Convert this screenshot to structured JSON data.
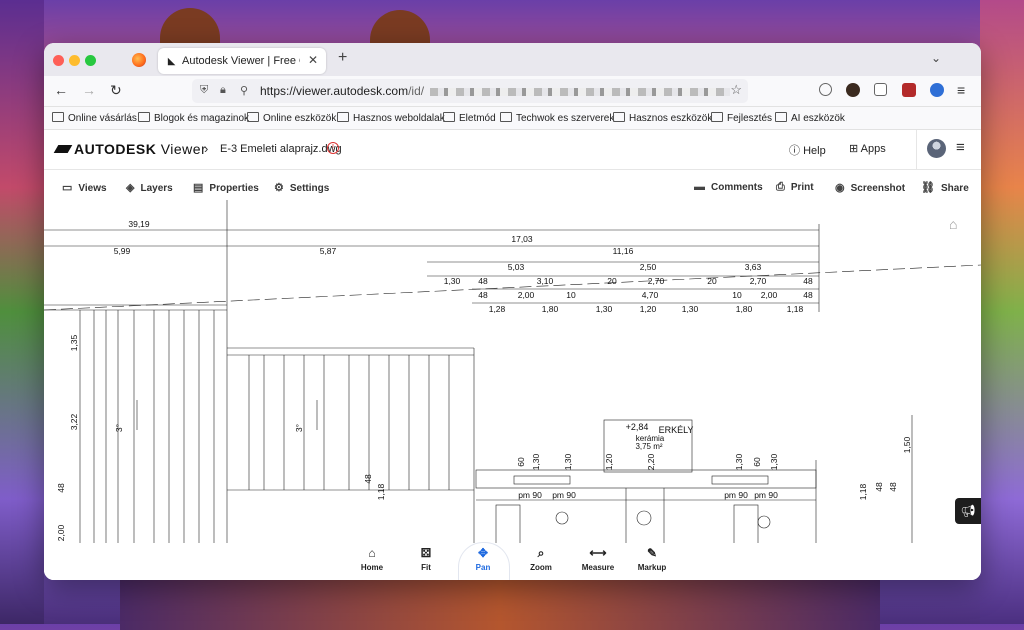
{
  "browser": {
    "tab_title": "Autodesk Viewer | Free Online F",
    "url_host": "https://viewer.autodesk.com",
    "url_path": "/id/"
  },
  "bookmarks": [
    "Online vásárlás",
    "Blogok és magazinok",
    "Online eszközök",
    "Hasznos weboldalak",
    "Eletmód",
    "Techwok es szerverek",
    "Hasznos eszközök",
    "Fejlesztés",
    "AI eszközök"
  ],
  "app": {
    "logo_bold": "AUTODESK",
    "logo_light": "Viewer",
    "file_name": "E-3 Emeleti alaprajz.dwg",
    "help_label": "Help",
    "apps_label": "Apps"
  },
  "toolbar": {
    "views": "Views",
    "layers": "Layers",
    "properties": "Properties",
    "settings": "Settings",
    "comments": "Comments",
    "print": "Print",
    "screenshot": "Screenshot",
    "share": "Share"
  },
  "bottom_tools": {
    "home": "Home",
    "fit": "Fit",
    "pan": "Pan",
    "zoom": "Zoom",
    "measure": "Measure",
    "markup": "Markup"
  },
  "drawing": {
    "dims_row1": [
      "39,19",
      "17,03"
    ],
    "dims_row2": [
      "5,99",
      "5,87",
      "11,16"
    ],
    "dims_row3": [
      "5,03",
      "2,50",
      "3,63"
    ],
    "dims_row4": [
      "1,30",
      "48",
      "3,10",
      "20",
      "2,70",
      "20",
      "2,70",
      "48"
    ],
    "dims_row5": [
      "48",
      "2,00",
      "10",
      "4,70",
      "10",
      "2,00",
      "48"
    ],
    "dims_row6": [
      "1,28",
      "1,80",
      "1,30",
      "1,20",
      "1,30",
      "1,80",
      "1,18"
    ],
    "left_dims": [
      "1,35",
      "3,22",
      "48",
      "2,00"
    ],
    "stair_label": "3°",
    "balcony": [
      "+2,84",
      "ERKÉLY",
      "kerámia",
      "3,75 m²"
    ],
    "window_dims": [
      "60",
      "1,30",
      "1,30",
      "1,20",
      "2,20",
      "1,30",
      "60",
      "1,30"
    ],
    "small_labels": [
      "pm 90",
      "pm 90",
      "pm 90",
      "pm 90",
      "1,18",
      "48",
      "48",
      "1,50",
      "1,18",
      "48"
    ]
  }
}
